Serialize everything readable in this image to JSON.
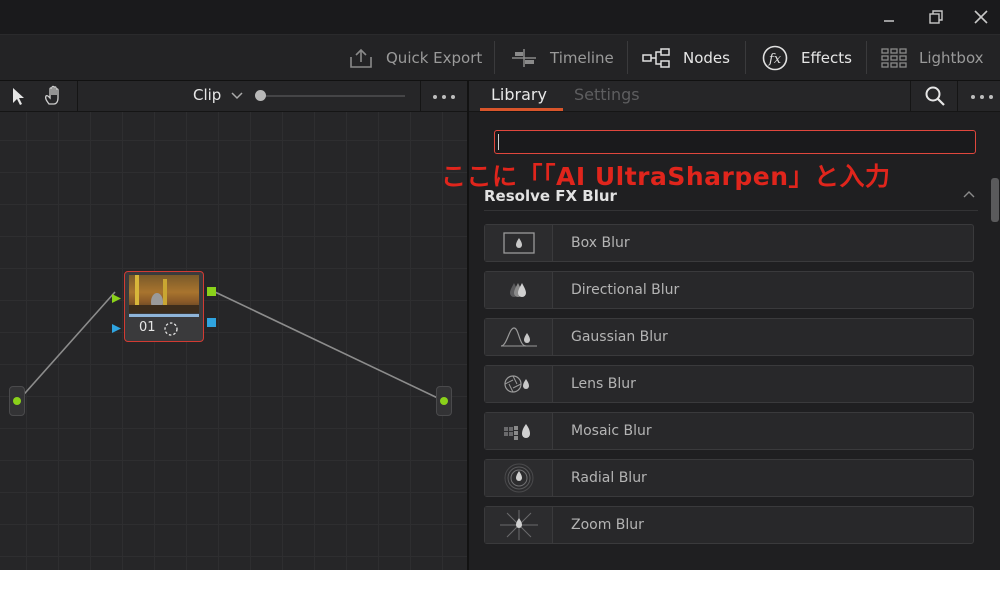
{
  "toolbar": {
    "quick_export": "Quick Export",
    "timeline": "Timeline",
    "nodes": "Nodes",
    "effects": "Effects",
    "lightbox": "Lightbox"
  },
  "node_panel": {
    "clip_label": "Clip",
    "node_number": "01"
  },
  "library_panel": {
    "tab_library": "Library",
    "tab_settings": "Settings",
    "search_value": "",
    "annotation": "ここに「「AI UltraSharpen」と入力",
    "section_title": "Resolve FX Blur",
    "effects": [
      {
        "label": "Box Blur",
        "icon": "box-blur-icon"
      },
      {
        "label": "Directional Blur",
        "icon": "directional-blur-icon"
      },
      {
        "label": "Gaussian Blur",
        "icon": "gaussian-blur-icon"
      },
      {
        "label": "Lens Blur",
        "icon": "lens-blur-icon"
      },
      {
        "label": "Mosaic Blur",
        "icon": "mosaic-blur-icon"
      },
      {
        "label": "Radial Blur",
        "icon": "radial-blur-icon"
      },
      {
        "label": "Zoom Blur",
        "icon": "zoom-blur-icon"
      }
    ]
  },
  "colors": {
    "accent_red": "#e0251c",
    "selected_node_border": "#d23b33",
    "port_green": "#8ad11a",
    "port_blue": "#2fa4e0"
  }
}
